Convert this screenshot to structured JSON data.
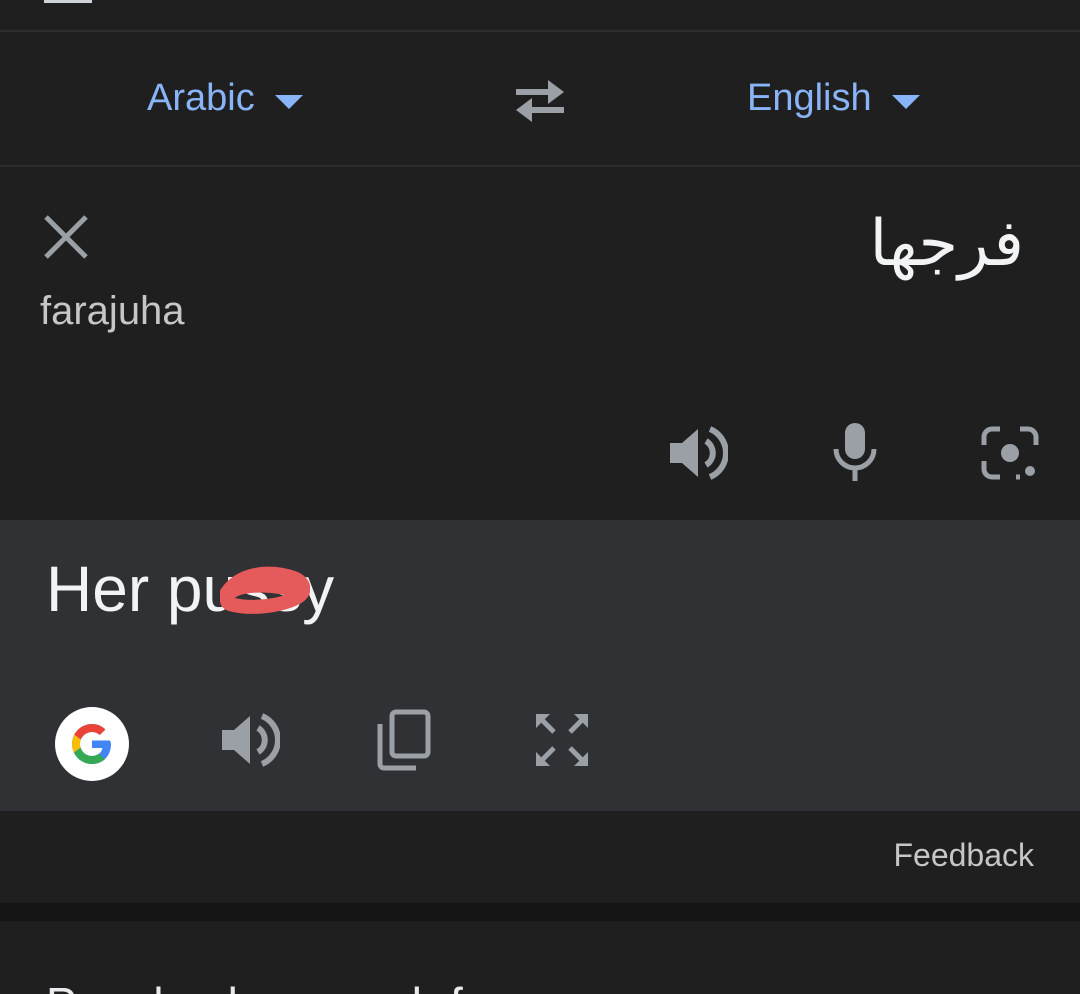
{
  "languages": {
    "source": "Arabic",
    "target": "English"
  },
  "source": {
    "text": "فرجها",
    "transliteration": "farajuha"
  },
  "result": {
    "text": "Her pussy"
  },
  "footer": {
    "feedback_label": "Feedback"
  },
  "people_also_search": {
    "title": "People also search for"
  },
  "icons": {
    "swap": "swap-languages-icon",
    "clear": "close-icon",
    "speaker": "speaker-icon",
    "mic": "microphone-icon",
    "camera": "camera-lens-icon",
    "google": "google-logo",
    "copy": "copy-icon",
    "fullscreen": "fullscreen-icon"
  },
  "colors": {
    "accent": "#8ab4f8",
    "background": "#1f1f1f",
    "result_background": "#303134",
    "redaction": "#e55a5a"
  }
}
